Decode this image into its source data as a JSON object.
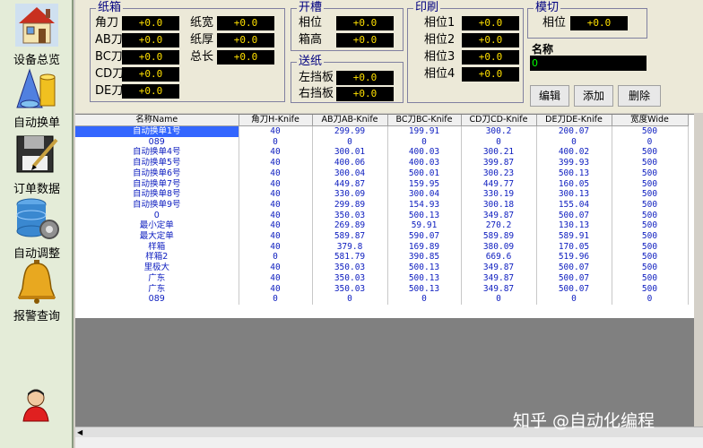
{
  "sidebar": {
    "items": [
      {
        "label": "设备总览",
        "icon": "house-icon"
      },
      {
        "label": "自动换单",
        "icon": "shapes-icon"
      },
      {
        "label": "订单数据",
        "icon": "floppy-pen-icon"
      },
      {
        "label": "自动调整",
        "icon": "database-gear-icon"
      },
      {
        "label": "报警查询",
        "icon": "bell-icon"
      }
    ]
  },
  "groups": {
    "carton": {
      "title": "纸箱",
      "fields": [
        {
          "label": "角刀",
          "value": "+0.0"
        },
        {
          "label": "AB刀",
          "value": "+0.0"
        },
        {
          "label": "BC刀",
          "value": "+0.0"
        },
        {
          "label": "CD刀",
          "value": "+0.0"
        },
        {
          "label": "DE刀",
          "value": "+0.0"
        },
        {
          "label": "纸宽",
          "value": "+0.0"
        },
        {
          "label": "纸厚",
          "value": "+0.0"
        },
        {
          "label": "总长",
          "value": "+0.0"
        }
      ]
    },
    "slot": {
      "title": "开槽",
      "fields": [
        {
          "label": "相位",
          "value": "+0.0"
        },
        {
          "label": "箱高",
          "value": "+0.0"
        }
      ]
    },
    "feed": {
      "title": "送纸",
      "fields": [
        {
          "label": "左挡板",
          "value": "+0.0"
        },
        {
          "label": "右挡板",
          "value": "+0.0"
        }
      ]
    },
    "print": {
      "title": "印刷",
      "fields": [
        {
          "label": "相位1",
          "value": "+0.0"
        },
        {
          "label": "相位2",
          "value": "+0.0"
        },
        {
          "label": "相位3",
          "value": "+0.0"
        },
        {
          "label": "相位4",
          "value": "+0.0"
        }
      ]
    },
    "diecut": {
      "title": "模切",
      "fields": [
        {
          "label": "相位",
          "value": "+0.0"
        }
      ]
    }
  },
  "name_field": {
    "label": "名称",
    "value": "0"
  },
  "buttons": {
    "edit": "编辑",
    "add": "添加",
    "delete": "删除"
  },
  "table": {
    "columns": [
      "名称Name",
      "角刀H-Knife",
      "AB刀AB-Knife",
      "BC刀BC-Knife",
      "CD刀CD-Knife",
      "DE刀DE-Knife",
      "宽度Wide"
    ],
    "rows": [
      [
        "自动换单1号",
        "40",
        "299.99",
        "199.91",
        "300.2",
        "200.07",
        "500"
      ],
      [
        "089",
        "0",
        "0",
        "0",
        "0",
        "0",
        "0"
      ],
      [
        "自动换单4号",
        "40",
        "300.01",
        "400.03",
        "300.21",
        "400.02",
        "500"
      ],
      [
        "自动换单5号",
        "40",
        "400.06",
        "400.03",
        "399.87",
        "399.93",
        "500"
      ],
      [
        "自动换单6号",
        "40",
        "300.04",
        "500.01",
        "300.23",
        "500.13",
        "500"
      ],
      [
        "自动换单7号",
        "40",
        "449.87",
        "159.95",
        "449.77",
        "160.05",
        "500"
      ],
      [
        "自动换单8号",
        "40",
        "330.09",
        "300.04",
        "330.19",
        "300.13",
        "500"
      ],
      [
        "自动换单9号",
        "40",
        "299.89",
        "154.93",
        "300.18",
        "155.04",
        "500"
      ],
      [
        "0",
        "40",
        "350.03",
        "500.13",
        "349.87",
        "500.07",
        "500"
      ],
      [
        "最小定单",
        "40",
        "269.89",
        "59.91",
        "270.2",
        "130.13",
        "500"
      ],
      [
        "最大定单",
        "40",
        "589.87",
        "590.07",
        "589.89",
        "589.91",
        "500"
      ],
      [
        "样箱",
        "40",
        "379.8",
        "169.89",
        "380.09",
        "170.05",
        "500"
      ],
      [
        "样箱2",
        "0",
        "581.79",
        "390.85",
        "669.6",
        "519.96",
        "500"
      ],
      [
        "里极大",
        "40",
        "350.03",
        "500.13",
        "349.87",
        "500.07",
        "500"
      ],
      [
        "广东",
        "40",
        "350.03",
        "500.13",
        "349.87",
        "500.07",
        "500"
      ],
      [
        "广东",
        "40",
        "350.03",
        "500.13",
        "349.87",
        "500.07",
        "500"
      ],
      [
        "089",
        "0",
        "0",
        "0",
        "0",
        "0",
        "0"
      ]
    ]
  },
  "watermark": "知乎 @自动化编程"
}
